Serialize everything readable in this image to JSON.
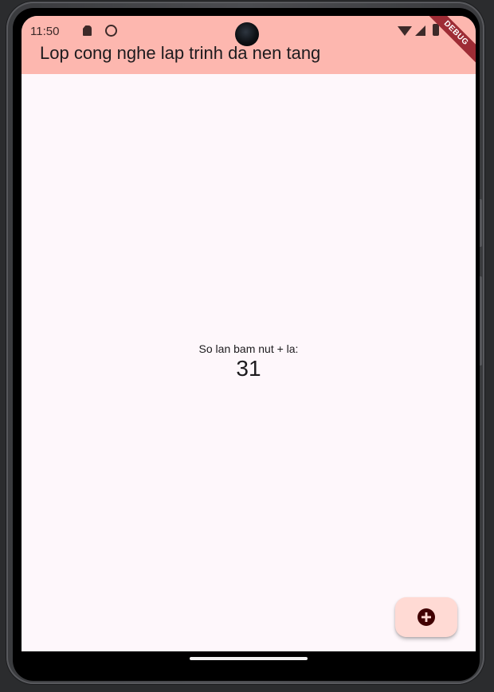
{
  "status_bar": {
    "time": "11:50"
  },
  "debug_banner": {
    "label": "DEBUG",
    "color": "#9d2c35"
  },
  "app_bar": {
    "title": "Lop cong nghe lap trinh da nen tang",
    "background": "#fdb7af"
  },
  "counter_view": {
    "caption": "So lan bam nut + la:",
    "count": "31"
  },
  "fab": {
    "icon": "add-circle-icon",
    "background": "#ffdad4"
  },
  "colors": {
    "screen_background": "#fef7fb",
    "text": "#1d1b1e",
    "icon_dark": "#3d2a29"
  }
}
